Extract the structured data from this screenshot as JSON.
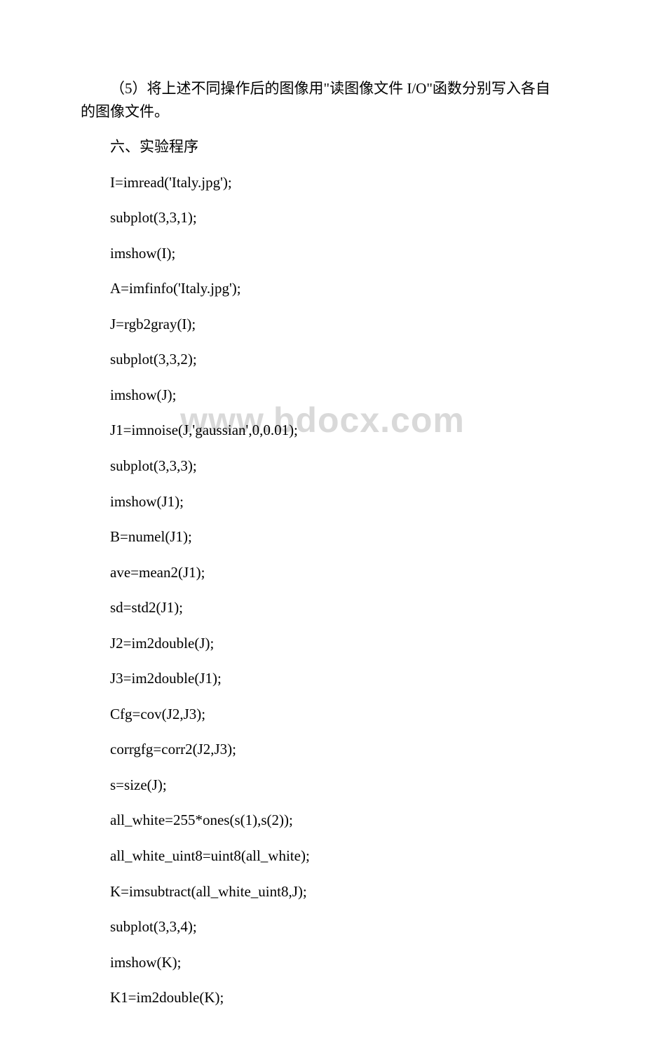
{
  "watermark": "www.bdocx.com",
  "paragraphs": {
    "p1": "（5）将上述不同操作后的图像用\"读图像文件 I/O\"函数分别写入各自的图像文件。",
    "p2": "六、实验程序"
  },
  "code": {
    "l1": "I=imread('Italy.jpg');",
    "l2": "subplot(3,3,1);",
    "l3": "imshow(I);",
    "l4": "A=imfinfo('Italy.jpg');",
    "l5": "J=rgb2gray(I);",
    "l6": "subplot(3,3,2);",
    "l7": "imshow(J);",
    "l8": "J1=imnoise(J,'gaussian',0,0.01);",
    "l9": "subplot(3,3,3);",
    "l10": "imshow(J1);",
    "l11": "B=numel(J1);",
    "l12": "ave=mean2(J1);",
    "l13": "sd=std2(J1);",
    "l14": "J2=im2double(J);",
    "l15": "J3=im2double(J1);",
    "l16": "Cfg=cov(J2,J3);",
    "l17": "corrgfg=corr2(J2,J3);",
    "l18": "s=size(J);",
    "l19": "all_white=255*ones(s(1),s(2));",
    "l20": "all_white_uint8=uint8(all_white);",
    "l21": "K=imsubtract(all_white_uint8,J);",
    "l22": "subplot(3,3,4);",
    "l23": "imshow(K);",
    "l24": "K1=im2double(K);"
  }
}
